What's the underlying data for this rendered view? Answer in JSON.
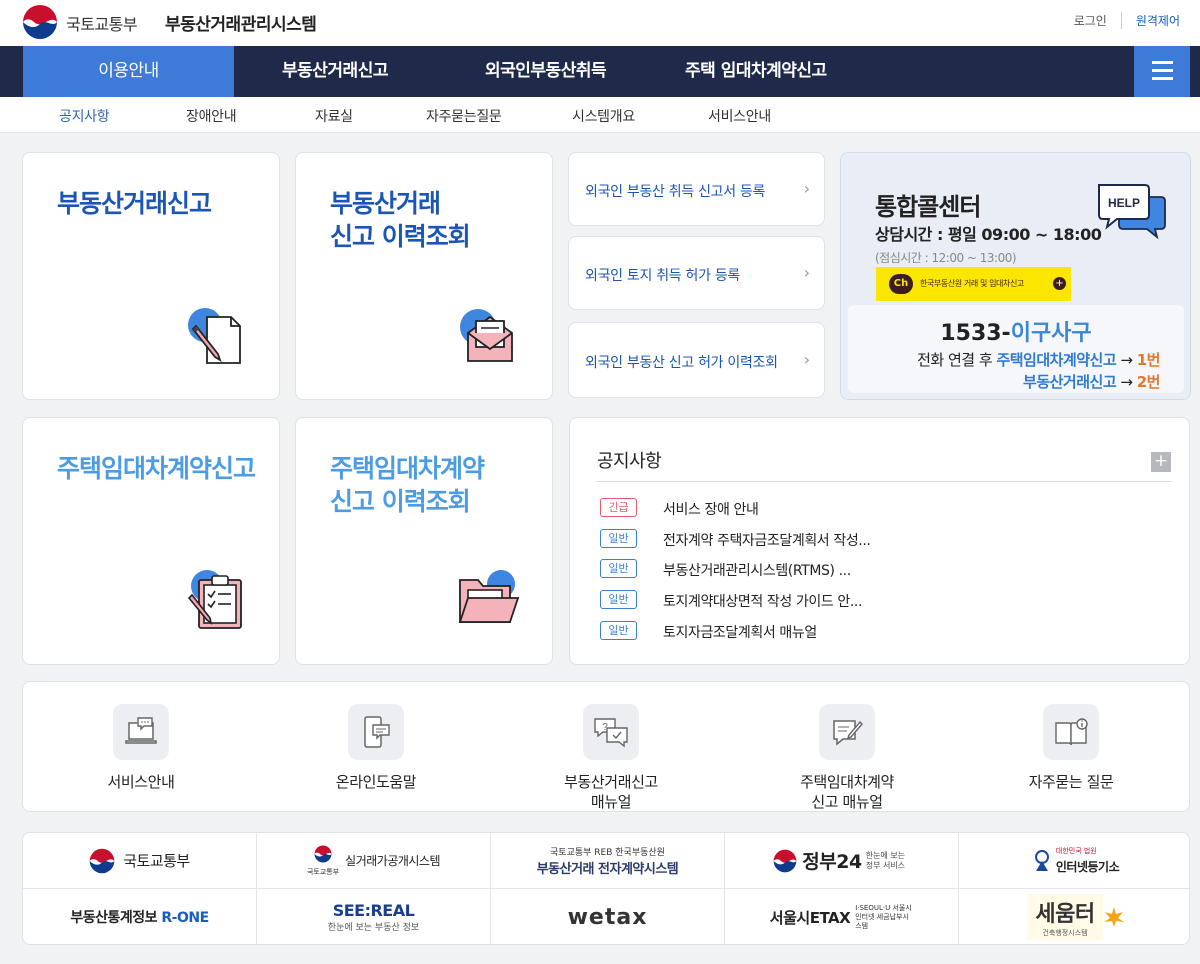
{
  "header": {
    "ministry": "국토교통부",
    "system_title": "부동산거래관리시스템",
    "login": "로그인",
    "remote": "원격제어"
  },
  "gnb": {
    "items": [
      "이용안내",
      "부동산거래신고",
      "외국인부동산취득",
      "주택 임대차계약신고"
    ],
    "active_index": 0
  },
  "lnb": {
    "items": [
      "공지사항",
      "장애안내",
      "자료실",
      "자주묻는질문",
      "시스템개요",
      "서비스안내"
    ],
    "active_index": 0
  },
  "cards": {
    "realestate_report": "부동산거래신고",
    "realestate_history": "부동산거래\n신고 이력조회",
    "lease_report": "주택임대차계약신고",
    "lease_history": "주택임대차계약\n신고 이력조회"
  },
  "foreign_links": [
    "외국인 부동산 취득 신고서 등록",
    "외국인 토지 취득 허가 등록",
    "외국인 부동산 신고 허가 이력조회"
  ],
  "call_center": {
    "title": "통합콜센터",
    "hours": "상담시간 : 평일 09:00 ~ 18:00",
    "lunch": "(점심시간 : 12:00 ~ 13:00)",
    "help_label": "HELP",
    "kakao_ch": "Ch",
    "kakao_text": "한국부동산원 거래 및 임대차신고",
    "phone_prefix": "1533-",
    "phone_word": "이구사구",
    "line1_prefix": "전화 연결 후 ",
    "line1_service": "주택임대차계약신고",
    "line1_arrow": " → ",
    "line1_num": "1번",
    "line2_service": "부동산거래신고",
    "line2_arrow": " → ",
    "line2_num": "2번"
  },
  "notice": {
    "title": "공지사항",
    "more": "+",
    "rows": [
      {
        "badge": "긴급",
        "urgent": true,
        "text": "서비스 장애 안내"
      },
      {
        "badge": "일반",
        "urgent": false,
        "text": "전자계약 주택자금조달계획서 작성..."
      },
      {
        "badge": "일반",
        "urgent": false,
        "text": "부동산거래관리시스템(RTMS) ..."
      },
      {
        "badge": "일반",
        "urgent": false,
        "text": "토지계약대상면적 작성 가이드 안..."
      },
      {
        "badge": "일반",
        "urgent": false,
        "text": "토지자금조달계획서 매뉴얼"
      }
    ]
  },
  "quick_links": [
    {
      "label": "서비스안내",
      "icon": "laptop-chat-icon"
    },
    {
      "label": "온라인도움말",
      "icon": "mobile-chat-icon"
    },
    {
      "label": "부동산거래신고\n매뉴얼",
      "icon": "question-chat-icon"
    },
    {
      "label": "주택임대차계약\n신고 매뉴얼",
      "icon": "document-edit-icon"
    },
    {
      "label": "자주묻는 질문",
      "icon": "book-info-icon"
    }
  ],
  "related_sites": [
    "국토교통부",
    "실거래가공개시스템",
    "부동산거래 전자계약시스템",
    "정부24",
    "인터넷등기소",
    "부동산통계정보 R-ONE",
    "SEE:REAL",
    "wetax",
    "서울시ETAX",
    "세움터"
  ],
  "related_sub": {
    "moltm_small": "국토교통부",
    "rone_prefix": "부동산통계정보 ",
    "rone_brand": "R-ONE",
    "seereal_sub": "한눈에 보는 부동산 정보",
    "reb_top": "국토교통부 REB 한국부동산원",
    "gov24_sub": "한눈에 보는 정부 서비스",
    "iros_top": "대한민국 법원",
    "etax_sub": "I·SEOUL·U 서울시 인터넷 세금납부시스템",
    "seumteo_sub": "건축행정시스템"
  },
  "colors": {
    "navy": "#1f2a4b",
    "accent_blue": "#3e7ad8",
    "title_blue": "#1c56b4",
    "light_blue": "#4b9ce3",
    "orange": "#e5762d",
    "urgent_red": "#e35d6a"
  }
}
